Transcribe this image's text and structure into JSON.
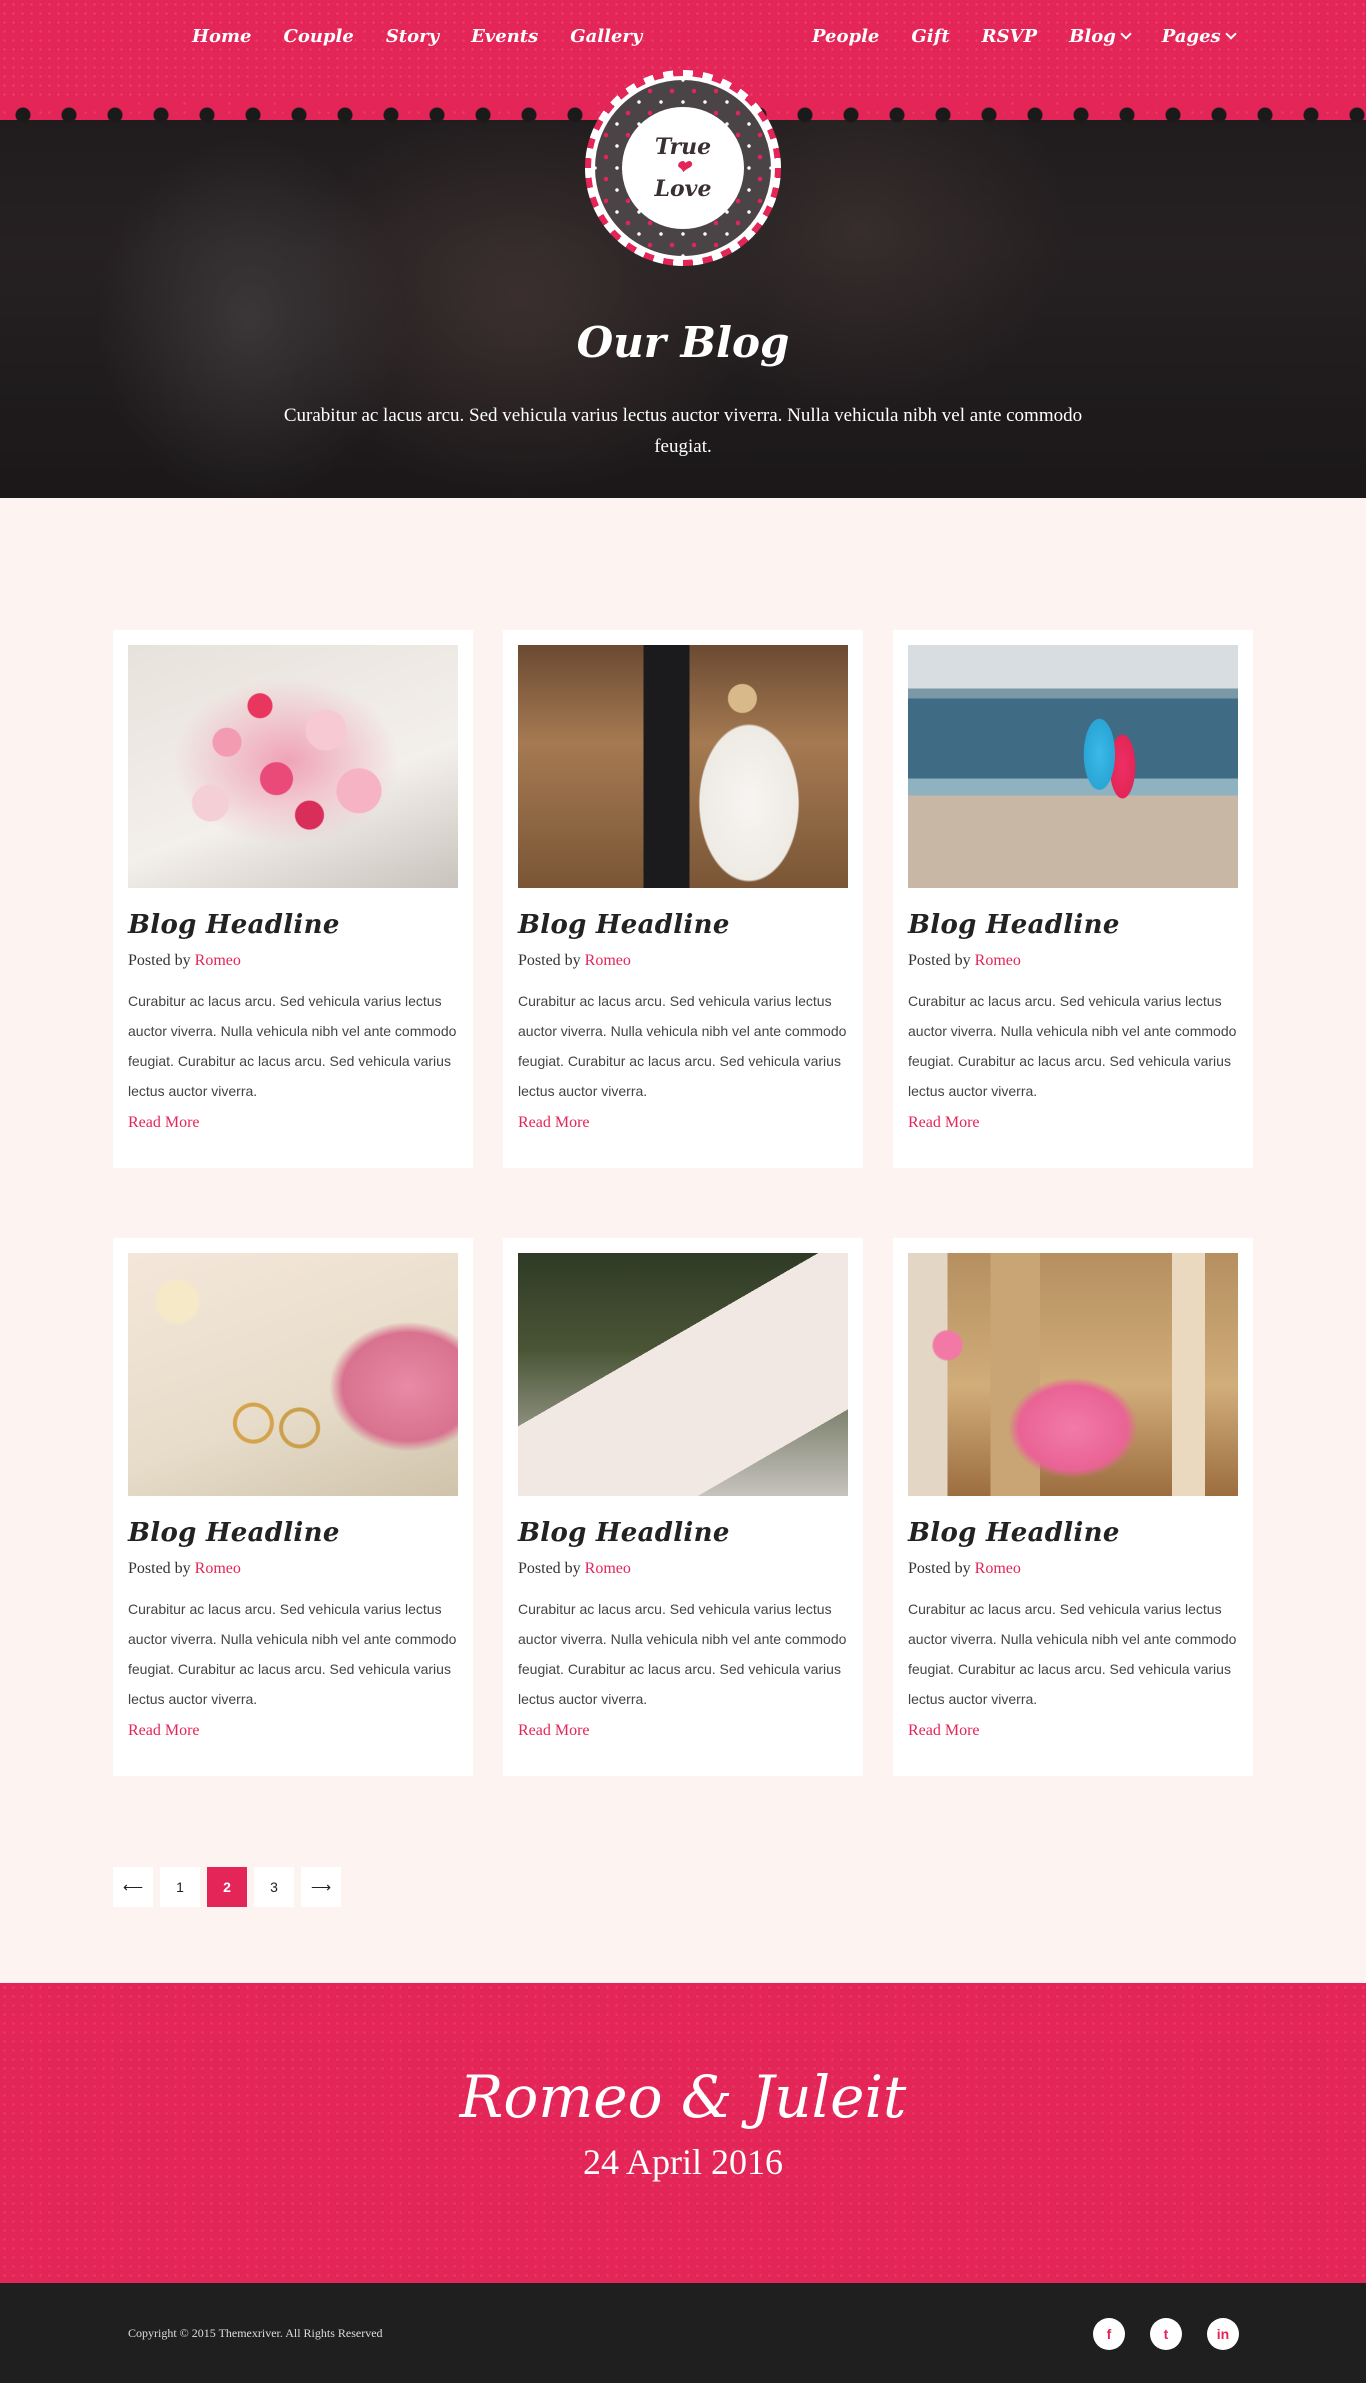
{
  "nav": {
    "left": [
      {
        "label": "Home"
      },
      {
        "label": "Couple"
      },
      {
        "label": "Story"
      },
      {
        "label": "Events"
      },
      {
        "label": "Gallery"
      }
    ],
    "right": [
      {
        "label": "People"
      },
      {
        "label": "Gift"
      },
      {
        "label": "RSVP"
      },
      {
        "label": "Blog"
      },
      {
        "label": "Pages"
      }
    ]
  },
  "logo": {
    "line1": "True",
    "heart": "❤",
    "line2": "Love"
  },
  "hero": {
    "title": "Our Blog",
    "subtitle": "Curabitur ac lacus arcu. Sed vehicula varius lectus auctor viverra. Nulla vehicula nibh vel ante commodo feugiat."
  },
  "posts": [
    {
      "title": "Blog Headline",
      "posted_by": "Posted by",
      "author": "Romeo",
      "excerpt": "Curabitur ac lacus arcu. Sed vehicula varius lectus auctor viverra. Nulla vehicula nibh vel ante commodo feugiat. Curabitur ac lacus arcu. Sed vehicula varius lectus auctor viverra.",
      "read_more": "Read More"
    },
    {
      "title": "Blog Headline",
      "posted_by": "Posted by",
      "author": "Romeo",
      "excerpt": "Curabitur ac lacus arcu. Sed vehicula varius lectus auctor viverra. Nulla vehicula nibh vel ante commodo feugiat. Curabitur ac lacus arcu. Sed vehicula varius lectus auctor viverra.",
      "read_more": "Read More"
    },
    {
      "title": "Blog Headline",
      "posted_by": "Posted by",
      "author": "Romeo",
      "excerpt": "Curabitur ac lacus arcu. Sed vehicula varius lectus auctor viverra. Nulla vehicula nibh vel ante commodo feugiat. Curabitur ac lacus arcu. Sed vehicula varius lectus auctor viverra.",
      "read_more": "Read More"
    },
    {
      "title": "Blog Headline",
      "posted_by": "Posted by",
      "author": "Romeo",
      "excerpt": "Curabitur ac lacus arcu. Sed vehicula varius lectus auctor viverra. Nulla vehicula nibh vel ante commodo feugiat. Curabitur ac lacus arcu. Sed vehicula varius lectus auctor viverra.",
      "read_more": "Read More"
    },
    {
      "title": "Blog Headline",
      "posted_by": "Posted by",
      "author": "Romeo",
      "excerpt": "Curabitur ac lacus arcu. Sed vehicula varius lectus auctor viverra. Nulla vehicula nibh vel ante commodo feugiat. Curabitur ac lacus arcu. Sed vehicula varius lectus auctor viverra.",
      "read_more": "Read More"
    },
    {
      "title": "Blog Headline",
      "posted_by": "Posted by",
      "author": "Romeo",
      "excerpt": "Curabitur ac lacus arcu. Sed vehicula varius lectus auctor viverra. Nulla vehicula nibh vel ante commodo feugiat. Curabitur ac lacus arcu. Sed vehicula varius lectus auctor viverra.",
      "read_more": "Read More"
    }
  ],
  "pagination": {
    "prev": "⟵",
    "pages": [
      "1",
      "2",
      "3"
    ],
    "current": "2",
    "next": "⟶"
  },
  "banner": {
    "names": "Romeo & Juleit",
    "date": "24 April 2016"
  },
  "footer": {
    "copyright": "Copyright © 2015 Themexriver. All Rights Reserved",
    "social": [
      {
        "icon": "facebook-icon",
        "glyph": "f"
      },
      {
        "icon": "twitter-icon",
        "glyph": "t"
      },
      {
        "icon": "linkedin-icon",
        "glyph": "in"
      }
    ]
  },
  "colors": {
    "accent": "#e32557",
    "footer": "#1f1f1f",
    "page_bg": "#fdf3f1"
  }
}
